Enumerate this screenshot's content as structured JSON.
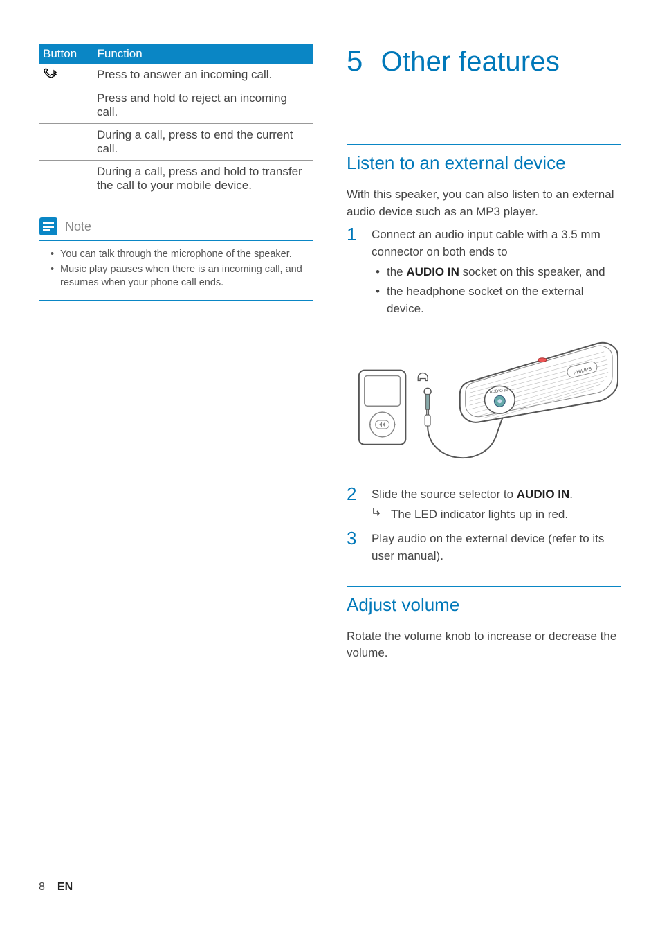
{
  "table": {
    "head": {
      "button": "Button",
      "function": "Function"
    },
    "rows": [
      {
        "icon": "phone-bt",
        "text": "Press to answer an incoming call."
      },
      {
        "icon": "",
        "text": "Press and hold to reject an incoming call."
      },
      {
        "icon": "",
        "text": "During a call, press to end the current call."
      },
      {
        "icon": "",
        "text": "During a call, press and hold to transfer the call to your mobile device."
      }
    ]
  },
  "note": {
    "title": "Note",
    "items": [
      "You can talk through the microphone of the speaker.",
      "Music play pauses when there is an incoming call, and resumes when your phone call ends."
    ]
  },
  "chapter": {
    "num": "5",
    "title": "Other features"
  },
  "section1": {
    "title": "Listen to an external device",
    "intro": "With this speaker, you can also listen to an external audio device such as an MP3 player.",
    "step1_lead": "Connect an audio input cable with a 3.5 mm connector on both ends to",
    "step1_b1_pre": "the ",
    "step1_b1_bold": "AUDIO IN",
    "step1_b1_post": " socket on this speaker, and",
    "step1_b2": "the headphone socket on the external device.",
    "step2_pre": "Slide the source selector to ",
    "step2_bold": "AUDIO IN",
    "step2_post": ".",
    "step2_result": "The LED indicator lights up in red.",
    "step3": "Play audio on the external device (refer to its user manual)."
  },
  "section2": {
    "title": "Adjust volume",
    "text": "Rotate the volume knob to increase or decrease the volume."
  },
  "footer": {
    "page": "8",
    "lang": "EN"
  }
}
